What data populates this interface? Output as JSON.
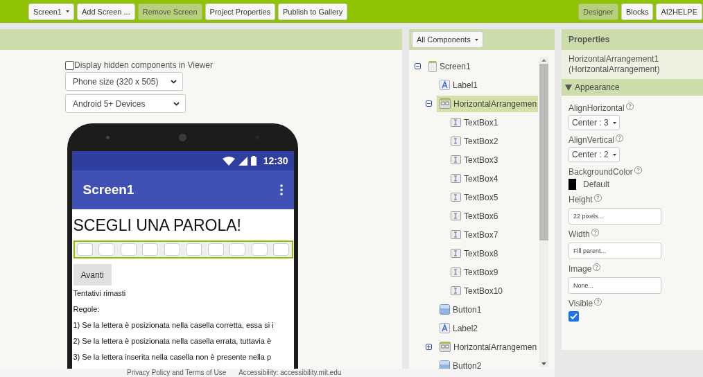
{
  "toolbar": {
    "left": [
      {
        "label": "Screen1",
        "kind": "dropdown",
        "disabled": false
      },
      {
        "label": "Add Screen ...",
        "kind": "button",
        "disabled": false
      },
      {
        "label": "Remove Screen",
        "kind": "button",
        "disabled": true
      },
      {
        "label": "Project Properties",
        "kind": "button",
        "disabled": false
      },
      {
        "label": "Publish to Gallery",
        "kind": "button",
        "disabled": false
      }
    ],
    "right": [
      {
        "label": "Designer",
        "selected": true
      },
      {
        "label": "Blocks",
        "selected": false
      },
      {
        "label": "AI2HELPE",
        "selected": false
      }
    ]
  },
  "viewer": {
    "hidden_checkbox": {
      "label": "Display hidden components in Viewer",
      "checked": false
    },
    "size_select": "Phone size (320 x 505)",
    "theme_select": "Android 5+ Devices",
    "phone": {
      "time": "12:30",
      "title": "Screen1",
      "heading": "SCEGLI UNA PAROLA!",
      "button": "Avanti",
      "lines": [
        "Tentativi rimasti",
        "Regole:",
        "1) Se la lettera è posizionata nella casella corretta, essa si i",
        "2) Se la lettera è posizionata nella casella errata, tuttavia è",
        "3) Se la lettera inserita nella casella non è presente nella p"
      ]
    }
  },
  "components": {
    "filter": "All Components",
    "tree": [
      {
        "label": "Screen1",
        "kind": "screen",
        "expanded": true,
        "selected": false,
        "children": [
          {
            "label": "Label1",
            "kind": "label",
            "selected": false
          },
          {
            "label": "HorizontalArrangemen",
            "kind": "arrangement",
            "expanded": true,
            "selected": true,
            "children": [
              {
                "label": "TextBox1",
                "kind": "textbox",
                "selected": false
              },
              {
                "label": "TextBox2",
                "kind": "textbox",
                "selected": false
              },
              {
                "label": "TextBox3",
                "kind": "textbox",
                "selected": false
              },
              {
                "label": "TextBox4",
                "kind": "textbox",
                "selected": false
              },
              {
                "label": "TextBox5",
                "kind": "textbox",
                "selected": false
              },
              {
                "label": "TextBox6",
                "kind": "textbox",
                "selected": false
              },
              {
                "label": "TextBox7",
                "kind": "textbox",
                "selected": false
              },
              {
                "label": "TextBox8",
                "kind": "textbox",
                "selected": false
              },
              {
                "label": "TextBox9",
                "kind": "textbox",
                "selected": false
              },
              {
                "label": "TextBox10",
                "kind": "textbox",
                "selected": false
              }
            ]
          },
          {
            "label": "Button1",
            "kind": "button",
            "selected": false
          },
          {
            "label": "Label2",
            "kind": "label",
            "selected": false
          },
          {
            "label": "HorizontalArrangemen",
            "kind": "arrangement",
            "expanded": false,
            "selected": false
          },
          {
            "label": "Button2",
            "kind": "button",
            "selected": false
          }
        ]
      }
    ]
  },
  "properties": {
    "title": "Properties",
    "component": "HorizontalArrangement1 (HorizontalArrangement)",
    "section": {
      "label": "Appearance",
      "expanded": true
    },
    "items": [
      {
        "name": "AlignHorizontal",
        "kind": "dropdown",
        "value": "Center : 3"
      },
      {
        "name": "AlignVertical",
        "kind": "dropdown",
        "value": "Center : 2"
      },
      {
        "name": "BackgroundColor",
        "kind": "color",
        "value": "Default",
        "color": "#000000"
      },
      {
        "name": "Height",
        "kind": "text",
        "value": "22 pixels..."
      },
      {
        "name": "Width",
        "kind": "text",
        "value": "Fill parent..."
      },
      {
        "name": "Image",
        "kind": "text",
        "value": "None..."
      },
      {
        "name": "Visible",
        "kind": "checkbox",
        "checked": true
      }
    ]
  },
  "footer": [
    "Privacy Policy and Terms of Use",
    "Accessibility: accessibility.mit.edu"
  ]
}
